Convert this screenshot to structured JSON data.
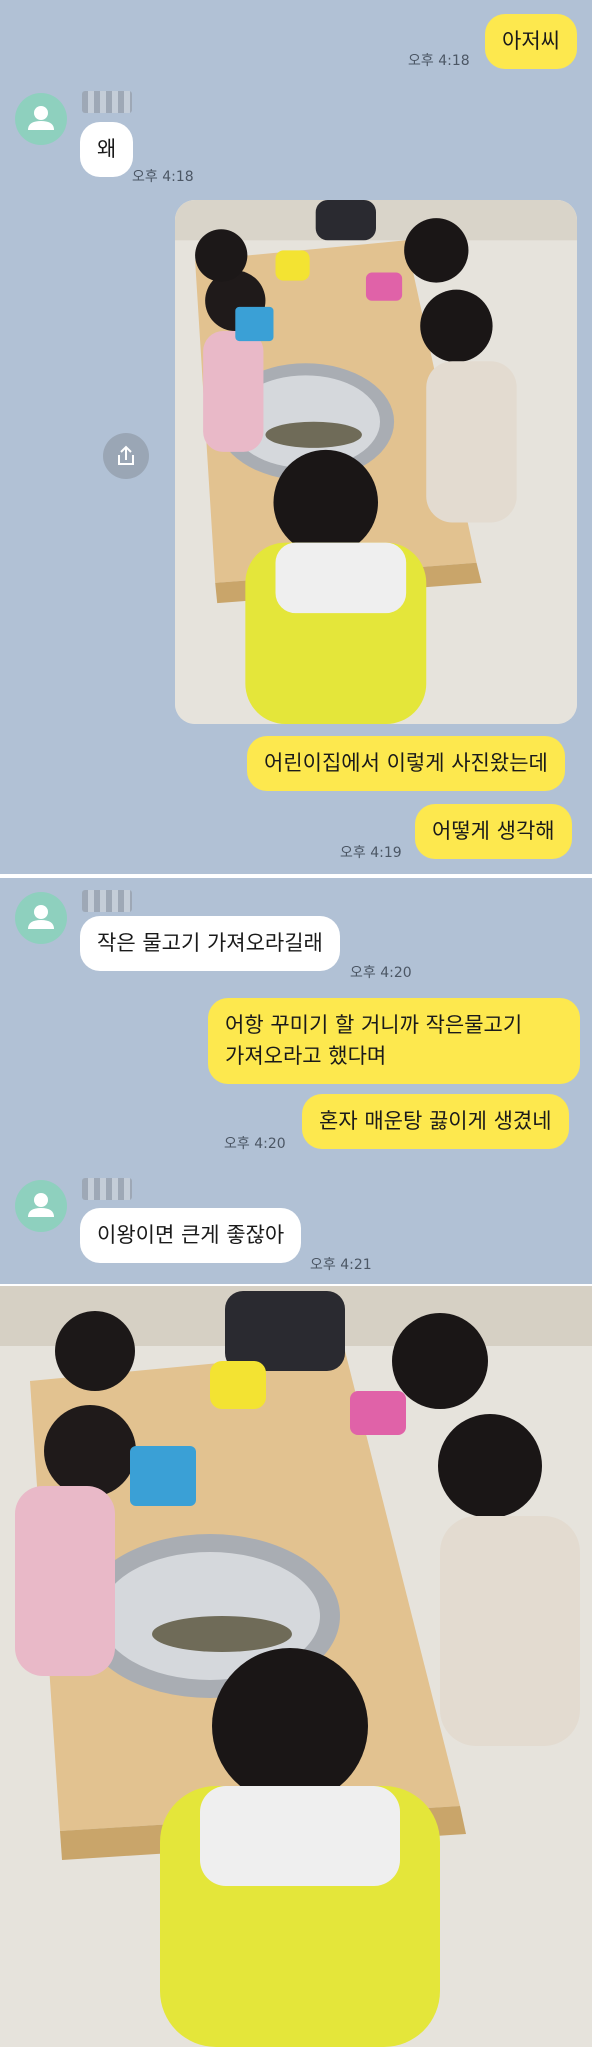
{
  "chat1": {
    "msg_me_1": "아저씨",
    "time_me_1": "오후 4:18",
    "msg_you_1": "왜",
    "time_you_1": "오후 4:18",
    "msg_me_2": "어린이집에서 이렇게 사진왔는데",
    "msg_me_3": "어떻게 생각해",
    "time_me_3": "오후 4:19"
  },
  "chat2": {
    "msg_you_1": "작은 물고기 가져오라길래",
    "time_you_1": "오후 4:20",
    "msg_me_1": "어항 꾸미기 할 거니까 작은물고기 가져오라고 했다며",
    "msg_me_2": "혼자 매운탕 끓이게 생겼네",
    "time_me_2": "오후 4:20",
    "msg_you_2": "이왕이면 큰게 좋잖아",
    "time_you_2": "오후 4:21"
  },
  "colors": {
    "chat_bg": "#b1c1d5",
    "my_bubble": "#fde84e",
    "their_bubble": "#ffffff",
    "avatar": "#8ed0be"
  },
  "icons": {
    "avatar": "person-icon",
    "share": "share-icon"
  }
}
